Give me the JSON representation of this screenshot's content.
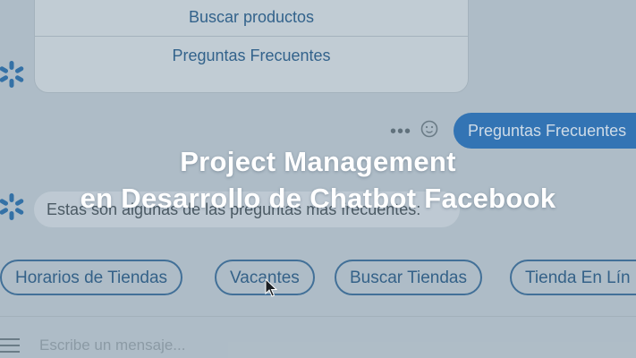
{
  "menu_card": {
    "options": [
      "Buscar productos",
      "Preguntas Frecuentes"
    ]
  },
  "user_message": {
    "dots": "•••",
    "text": "Preguntas Frecuentes"
  },
  "bot_message": {
    "text": "Estas son algunas de las preguntas más frecuentes:"
  },
  "quick_replies": [
    "Horarios de Tiendas",
    "Vacantes",
    "Buscar Tiendas",
    "Tienda En Lín"
  ],
  "composer": {
    "placeholder": "Escribe un mensaje..."
  },
  "overlay_title": {
    "line1": "Project Management",
    "line2": "en Desarrollo de Chatbot Facebook"
  },
  "colors": {
    "user_bubble": "#2e72b7",
    "quick_reply_border": "#3e6e98",
    "title": "#ffffff"
  },
  "icons": [
    "walmart-spark-icon",
    "emoji-icon",
    "hamburger-menu-icon",
    "mouse-cursor-icon"
  ]
}
